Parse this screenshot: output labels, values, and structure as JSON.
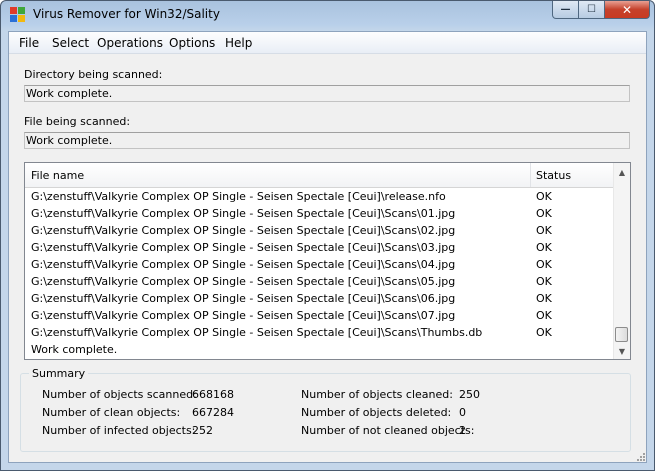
{
  "window": {
    "title": "Virus Remover for Win32/Sality"
  },
  "caption_buttons": {
    "minimize": "—",
    "maximize": "☐",
    "close": "✕"
  },
  "menu": [
    "File",
    "Select",
    "Operations",
    "Options",
    "Help"
  ],
  "directory": {
    "label": "Directory being scanned:",
    "value": "Work complete."
  },
  "file": {
    "label": "File being scanned:",
    "value": "Work complete."
  },
  "list": {
    "columns": [
      "File name",
      "Status"
    ],
    "rows": [
      {
        "name": "G:\\zenstuff\\Valkyrie Complex OP Single - Seisen Spectale [Ceui]\\release.nfo",
        "status": "OK"
      },
      {
        "name": "G:\\zenstuff\\Valkyrie Complex OP Single - Seisen Spectale [Ceui]\\Scans\\01.jpg",
        "status": "OK"
      },
      {
        "name": "G:\\zenstuff\\Valkyrie Complex OP Single - Seisen Spectale [Ceui]\\Scans\\02.jpg",
        "status": "OK"
      },
      {
        "name": "G:\\zenstuff\\Valkyrie Complex OP Single - Seisen Spectale [Ceui]\\Scans\\03.jpg",
        "status": "OK"
      },
      {
        "name": "G:\\zenstuff\\Valkyrie Complex OP Single - Seisen Spectale [Ceui]\\Scans\\04.jpg",
        "status": "OK"
      },
      {
        "name": "G:\\zenstuff\\Valkyrie Complex OP Single - Seisen Spectale [Ceui]\\Scans\\05.jpg",
        "status": "OK"
      },
      {
        "name": "G:\\zenstuff\\Valkyrie Complex OP Single - Seisen Spectale [Ceui]\\Scans\\06.jpg",
        "status": "OK"
      },
      {
        "name": "G:\\zenstuff\\Valkyrie Complex OP Single - Seisen Spectale [Ceui]\\Scans\\07.jpg",
        "status": "OK"
      },
      {
        "name": "G:\\zenstuff\\Valkyrie Complex OP Single - Seisen Spectale [Ceui]\\Scans\\Thumbs.db",
        "status": "OK"
      },
      {
        "name": "Work complete.",
        "status": ""
      }
    ]
  },
  "summary": {
    "title": "Summary",
    "scanned_label": "Number of objects scanned:",
    "scanned": "668168",
    "clean_label": "Number of clean objects:",
    "clean": "667284",
    "infected_label": "Number of infected objects:",
    "infected": "252",
    "cleaned_label": "Number of objects cleaned:",
    "cleaned": "250",
    "deleted_label": "Number of objects deleted:",
    "deleted": "0",
    "not_cleaned_label": "Number of not cleaned objects:",
    "not_cleaned": "2"
  },
  "icons": {
    "app": "sality-remover-app-icon",
    "scroll_up": "▲",
    "scroll_down": "▼"
  },
  "colors": {
    "titlebar": "#b9d0ea",
    "close_button": "#c83a22",
    "list_border": "#828790"
  }
}
